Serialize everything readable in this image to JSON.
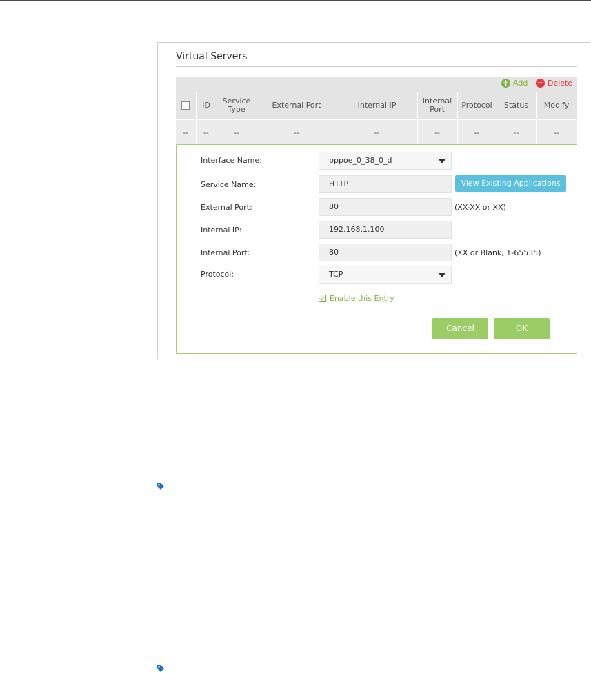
{
  "panel": {
    "title": "Virtual Servers",
    "toolbar": {
      "add_label": "Add",
      "delete_label": "Delete"
    },
    "table": {
      "headers": [
        "ID",
        "Service Type",
        "External Port",
        "Internal IP",
        "Internal Port",
        "Protocol",
        "Status",
        "Modify"
      ],
      "row": [
        "--",
        "--",
        "--",
        "--",
        "--",
        "--",
        "--",
        "--",
        "--"
      ]
    },
    "form": {
      "interface_label": "Interface Name:",
      "interface_value": "pppoe_0_38_0_d",
      "service_label": "Service Name:",
      "service_value": "HTTP",
      "view_apps_label": "View Existing Applications",
      "external_port_label": "External Port:",
      "external_port_value": "80",
      "external_port_hint": "(XX-XX or XX)",
      "internal_ip_label": "Internal IP:",
      "internal_ip_value": "192.168.1.100",
      "internal_port_label": "Internal Port:",
      "internal_port_value": "80",
      "internal_port_hint": "(XX or Blank, 1-65535)",
      "protocol_label": "Protocol:",
      "protocol_value": "TCP",
      "enable_label": "Enable this Entry",
      "enable_checked": true,
      "cancel_label": "Cancel",
      "ok_label": "OK"
    }
  },
  "icons": {
    "add": "plus-circle-icon",
    "delete": "minus-circle-icon",
    "note": "tag-icon"
  },
  "colors": {
    "accent_green": "#9ccc65",
    "info_blue": "#5bc0de",
    "delete_red": "#e33b3b",
    "note_blue": "#1a73c8"
  }
}
